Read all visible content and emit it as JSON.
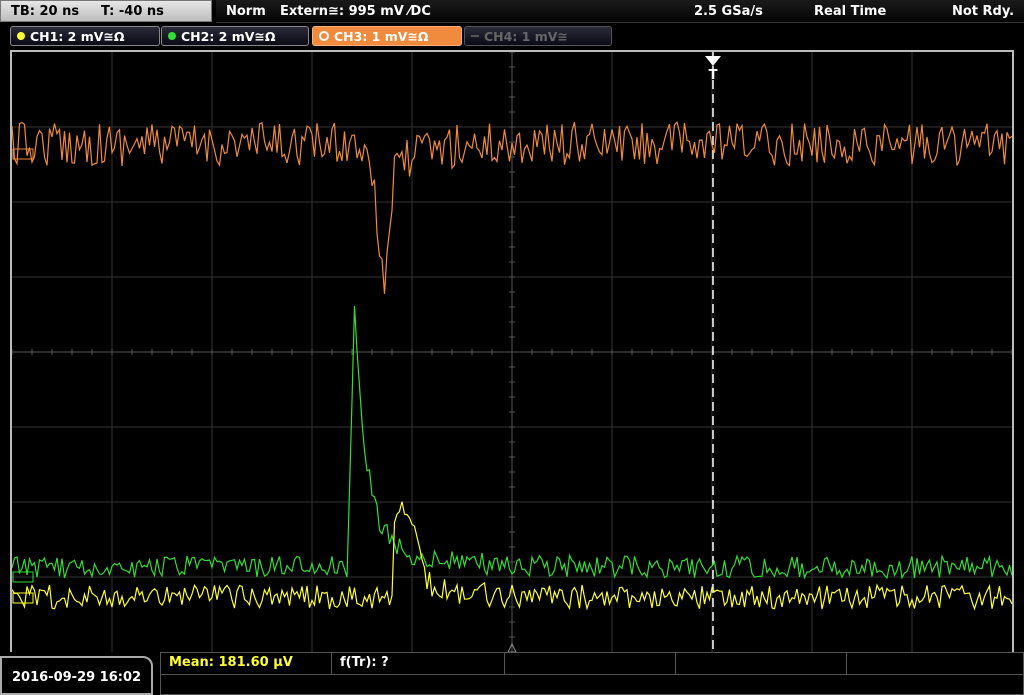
{
  "timebase": {
    "tb": "TB: 20 ns",
    "t": "T: -40 ns"
  },
  "status": {
    "mode": "Norm",
    "trigger": "Extern≅: 995 mV ⁄DC",
    "sample_rate": "2.5 GSa/s",
    "acq": "Real Time",
    "state": "Not Rdy."
  },
  "channels": [
    {
      "label": "CH1: 2 mV≅Ω",
      "color": "#ffff33"
    },
    {
      "label": "CH2: 2 mV≅Ω",
      "color": "#33dd33"
    },
    {
      "label": "CH3: 1 mV≅Ω",
      "color": "#f08a3c"
    },
    {
      "label": "CH4: 1 mV≅",
      "color": "#666666"
    }
  ],
  "trigger_marker": "T",
  "footer": {
    "datetime": "2016-09-29 16:02",
    "mean": "Mean: 181.60 µV",
    "ftr": "f(Tr): ?"
  },
  "colors": {
    "ch1": "#ffff33",
    "ch2": "#33dd33",
    "ch3": "#f08a3c",
    "grid": "#3a3a3a"
  }
}
